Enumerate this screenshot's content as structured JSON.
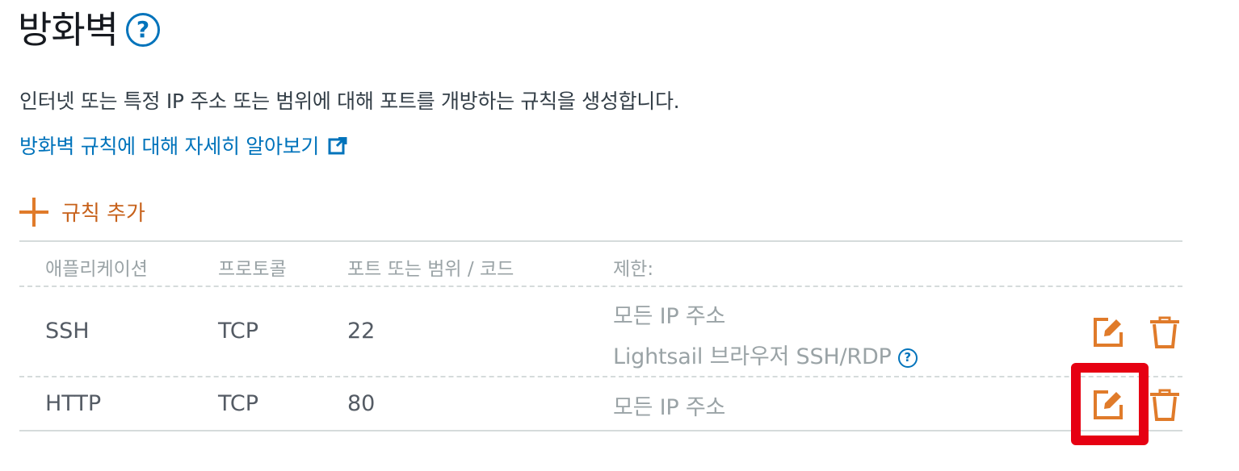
{
  "header": {
    "title": "방화벽",
    "help_glyph": "?",
    "description": "인터넷 또는 특정 IP 주소 또는 범위에 대해 포트를 개방하는 규칙을 생성합니다.",
    "learn_more": "방화벽 규칙에 대해 자세히 알아보기"
  },
  "add_rule": {
    "label": "규칙 추가",
    "icon": "plus-icon"
  },
  "table": {
    "columns": [
      "애플리케이션",
      "프로토콜",
      "포트 또는 범위 / 코드",
      "제한:"
    ],
    "rows": [
      {
        "application": "SSH",
        "protocol": "TCP",
        "port": "22",
        "restriction": "모든 IP 주소",
        "restriction_extra": "Lightsail 브라우저 SSH/RDP",
        "help_glyph": "?"
      },
      {
        "application": "HTTP",
        "protocol": "TCP",
        "port": "80",
        "restriction": "모든 IP 주소"
      }
    ]
  },
  "colors": {
    "accent_orange": "#e07b2a",
    "link_blue": "#0073bb",
    "highlight_red": "#e60012"
  }
}
